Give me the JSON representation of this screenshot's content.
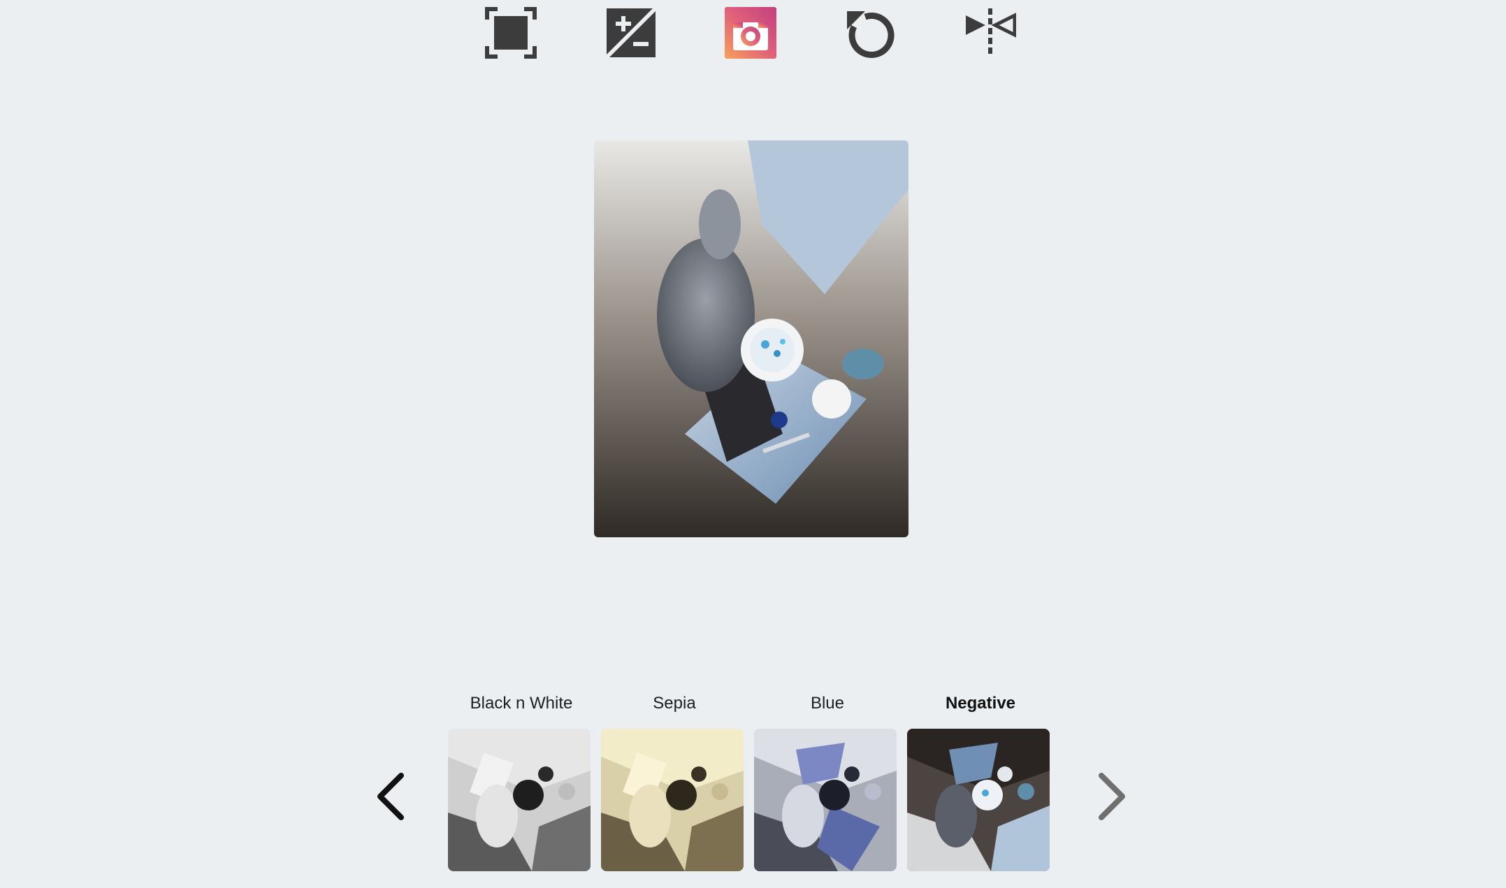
{
  "toolbar": {
    "items": [
      {
        "name": "crop",
        "icon": "crop-frame-icon"
      },
      {
        "name": "exposure",
        "icon": "exposure-plus-minus-icon"
      },
      {
        "name": "filters",
        "icon": "instagram-camera-icon",
        "accent": "#d4476e"
      },
      {
        "name": "rotate",
        "icon": "rotate-counterclockwise-icon"
      },
      {
        "name": "flip",
        "icon": "flip-horizontal-icon"
      }
    ]
  },
  "preview": {
    "icon": "photo-preview",
    "filter_applied": "Negative"
  },
  "filters": {
    "items": [
      {
        "label": "Black n White",
        "active": false
      },
      {
        "label": "Sepia",
        "active": false
      },
      {
        "label": "Blue",
        "active": false
      },
      {
        "label": "Negative",
        "active": true
      }
    ]
  },
  "nav": {
    "prev_icon": "chevron-left-icon",
    "next_icon": "chevron-right-icon"
  },
  "colors": {
    "background": "#eceff2",
    "icon": "#3a3a3a",
    "instagram_gradient_start": "#f5a55a",
    "instagram_gradient_end": "#c13584"
  }
}
